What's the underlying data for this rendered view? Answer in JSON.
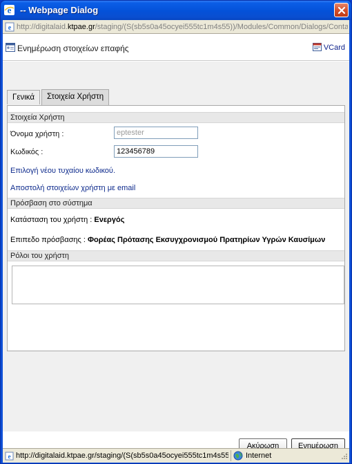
{
  "window": {
    "title": "-- Webpage Dialog",
    "address_url": "http://digitalaid.ktpae.gr/staging/(S(sb5s0a45ocyei555tc1m4s55))/Modules/Common/Dialogs/Conta",
    "address_host": "ktpae.gr"
  },
  "header": {
    "title": "Ενημέρωση στοιχείων επαφής",
    "vcard_label": "VCard"
  },
  "tabs": [
    {
      "label": "Γενικά",
      "active": false
    },
    {
      "label": "Στοιχεία Χρήστη",
      "active": true
    }
  ],
  "user_section": {
    "header": "Στοιχεία Χρήστη",
    "username_label": "Όνομα χρήστη :",
    "username_value": "eptester",
    "password_label": "Κωδικός :",
    "password_value": "123456789",
    "random_password_link": "Επιλογή νέου τυχαίου κωδικού.",
    "send_email_link": "Αποστολή στοιχείων χρήστη με email"
  },
  "access_section": {
    "header": "Πρόσβαση στο σύστημα",
    "status_label": "Κατάσταση του χρήστη :",
    "status_value": "Ενεργός",
    "access_level_label": "Επιπεδο πρόσβασης :",
    "access_level_value": "Φορέας Πρότασης Εκσυγχρονισμού Πρατηρίων Υγρών Καυσίμων"
  },
  "roles_section": {
    "header": "Ρόλοι του χρήστη"
  },
  "buttons": {
    "cancel": "Ακύρωση",
    "update": "Ενημέρωση"
  },
  "statusbar": {
    "url": "http://digitalaid.ktpae.gr/staging/(S(sb5s0a45ocyei555tc1m4s55))/M",
    "zone": "Internet"
  },
  "icons": {
    "title": "ie-icon",
    "close": "close-icon",
    "address": "page-icon",
    "header": "contact-card-icon",
    "vcard": "vcard-icon",
    "status_zone": "globe-icon"
  },
  "colors": {
    "titlebar": "#0451d8",
    "link": "#0d2a8c",
    "close_button": "#d6502b"
  }
}
